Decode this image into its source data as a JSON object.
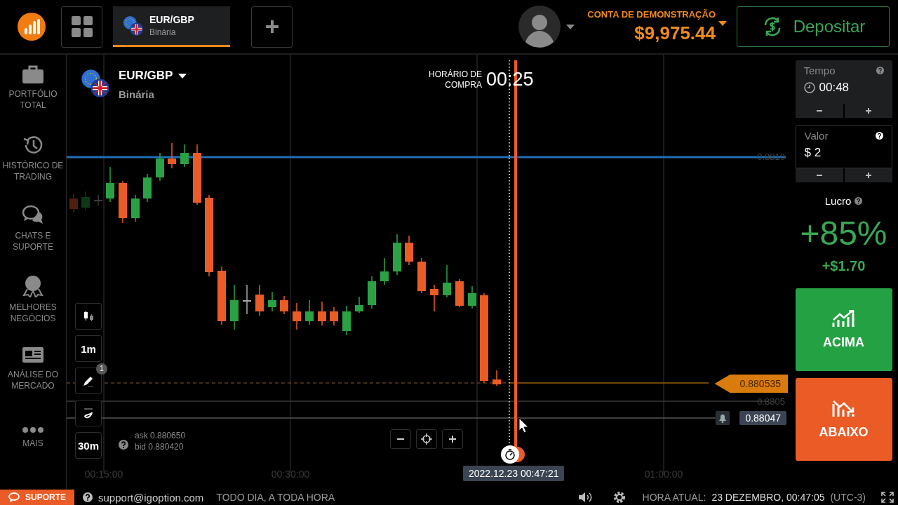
{
  "top_bar": {
    "tabs": [
      {
        "pair": "EUR/GBP",
        "type": "Binária",
        "selected": true
      }
    ],
    "account": {
      "label": "CONTA DE DEMONSTRAÇÃO",
      "balance": "$9,975.44"
    },
    "deposit_button": "Depositar"
  },
  "sidebar": {
    "items": [
      {
        "label": "PORTFÓLIO TOTAL"
      },
      {
        "label": "HISTÓRICO DE TRADING"
      },
      {
        "label": "CHATS E SUPORTE"
      },
      {
        "label": "MELHORES NEGÓCIOS"
      },
      {
        "label": "ANÁLISE DO MERCADO"
      },
      {
        "label": "MAIS"
      }
    ]
  },
  "chart": {
    "asset": {
      "pair": "EUR/GBP",
      "type": "Binária"
    },
    "purchase_time": {
      "label": "HORÁRIO DE COMPRA",
      "value": "00:25"
    },
    "price_levels": [
      "0.8810",
      "0.8805"
    ],
    "current_price": "0.880535",
    "alert_price": "0.88047",
    "ask": "ask 0.880650",
    "bid": "bid 0.880420",
    "time_labels": [
      "00:15:00",
      "00:30:00",
      "01:00:00"
    ],
    "cursor_time": "2022.12.23 00:47:21",
    "tools": [
      {
        "kind": "chart-type"
      },
      {
        "kind": "timeframe",
        "label": "1m"
      },
      {
        "kind": "drawing",
        "badge": "1"
      },
      {
        "kind": "indicator"
      },
      {
        "kind": "timeframe",
        "label": "30m"
      }
    ]
  },
  "trade_panel": {
    "time": {
      "label": "Tempo",
      "value": "00:48"
    },
    "amount": {
      "label": "Valor",
      "value": "$ 2"
    },
    "profit": {
      "label": "Lucro",
      "percent": "+85%",
      "amount": "+$1.70"
    },
    "buttons": [
      {
        "kind": "up",
        "label": "ACIMA"
      },
      {
        "kind": "down",
        "label": "ABAIXO"
      }
    ]
  },
  "footer": {
    "support_button": "SUPORTE",
    "email": "support@igoption.com",
    "hours": "TODO DIA, A TODA HORA",
    "clock_label": "HORA ATUAL:",
    "clock_value": "23 DEZEMBRO, 00:47:05",
    "timezone": "(UTC-3)"
  }
}
